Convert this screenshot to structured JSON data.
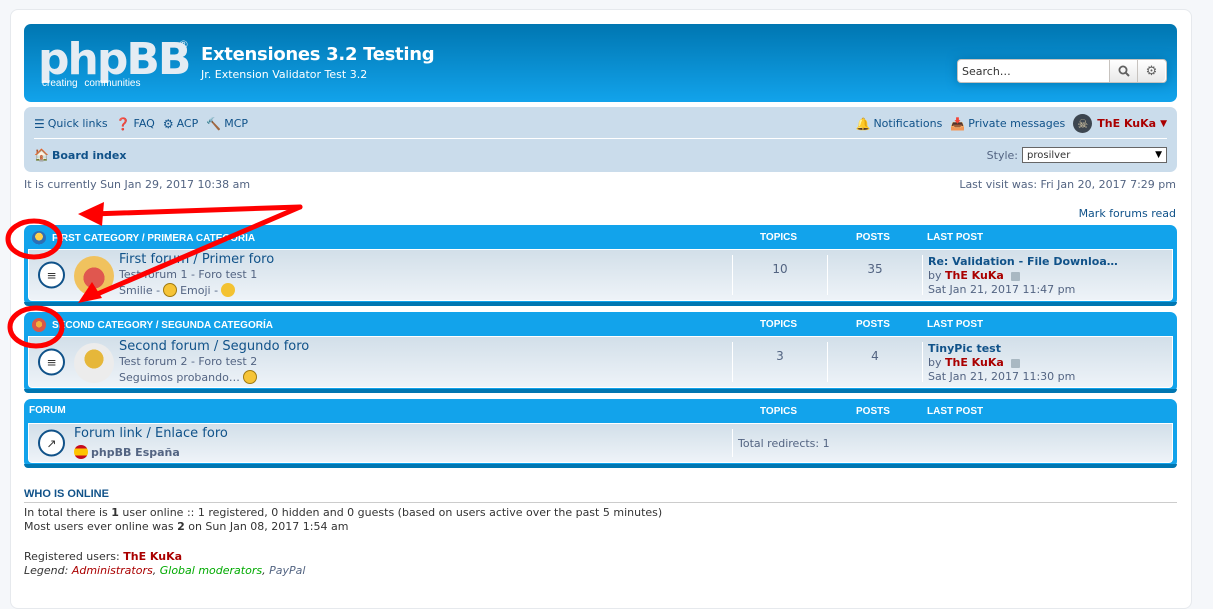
{
  "header": {
    "logo_text": "phpBB",
    "logo_tagline": [
      "creating",
      "communities"
    ],
    "site_title": "Extensiones 3.2 Testing",
    "site_description": "Jr. Extension Validator Test 3.2",
    "search": {
      "placeholder": "Search…",
      "search_icon": "search-icon",
      "advanced_icon": "gear-icon"
    }
  },
  "navbar": {
    "quick_links": "Quick links",
    "faq": "FAQ",
    "acp": "ACP",
    "mcp": "MCP",
    "notifications": "Notifications",
    "private_messages": "Private messages",
    "username": "ThE KuKa",
    "board_index": "Board index",
    "style_label": "Style:",
    "style_value": "prosilver"
  },
  "meta": {
    "current_time": "It is currently Sun Jan 29, 2017 10:38 am",
    "last_visit": "Last visit was: Fri Jan 20, 2017 7:29 pm",
    "mark_read": "Mark forums read"
  },
  "columns": {
    "topics": "TOPICS",
    "posts": "POSTS",
    "last_post": "LAST POST"
  },
  "categories": [
    {
      "title": "FIRST CATEGORY / PRIMERA CATEGORIA",
      "forum": {
        "title": "First forum / Primer foro",
        "description": "Test forum 1 - Foro test 1",
        "extra_a": "Smilie -",
        "extra_b": "Emoji -",
        "topics": "10",
        "posts": "35",
        "last_post_title": "Re: Validation - File Downloa…",
        "last_post_by": "by",
        "last_post_author": "ThE KuKa",
        "last_post_date": "Sat Jan 21, 2017 11:47 pm"
      }
    },
    {
      "title": "SECOND CATEGORY / SEGUNDA CATEGORÍA",
      "forum": {
        "title": "Second forum / Segundo foro",
        "description": "Test forum 2 - Foro test 2",
        "extra_a": "Seguimos probando…",
        "topics": "3",
        "posts": "4",
        "last_post_title": "TinyPic test",
        "last_post_by": "by",
        "last_post_author": "ThE KuKa",
        "last_post_date": "Sat Jan 21, 2017 11:30 pm"
      }
    },
    {
      "title": "FORUM",
      "forum": {
        "title": "Forum link / Enlace foro",
        "sublink": "phpBB España",
        "redirects": "Total redirects: 1"
      }
    }
  ],
  "who_is_online": {
    "heading": "WHO IS ONLINE",
    "line1_a": "In total there is ",
    "line1_count": "1",
    "line1_b": " user online :: 1 registered, 0 hidden and 0 guests (based on users active over the past 5 minutes)",
    "line2_a": "Most users ever online was ",
    "line2_count": "2",
    "line2_b": " on Sun Jan 08, 2017 1:54 am",
    "registered_label": "Registered users: ",
    "registered_user": "ThE KuKa",
    "legend_label": "Legend: ",
    "legend": [
      "Administrators",
      "Global moderators",
      "PayPal"
    ]
  },
  "colors": {
    "header_blue": "#12a3eb",
    "link": "#105289",
    "admin": "#aa0000",
    "global_mod": "#00aa00",
    "annotation": "#ff0000"
  }
}
